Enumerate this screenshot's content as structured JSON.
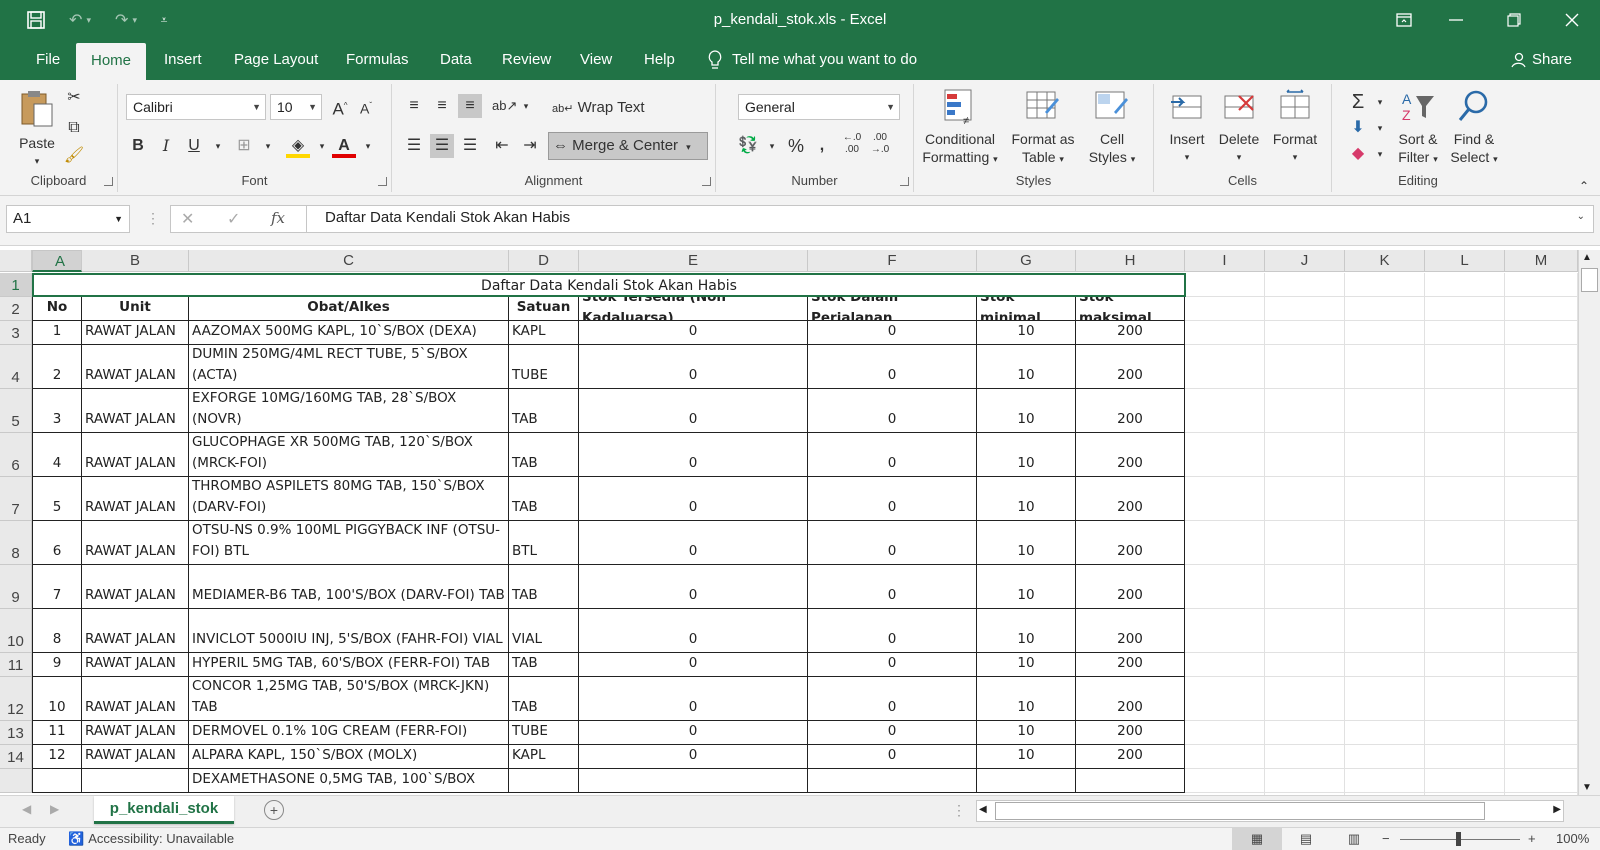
{
  "window": {
    "title": "p_kendali_stok.xls  -  Excel",
    "share_label": "Share"
  },
  "tabs": [
    "File",
    "Home",
    "Insert",
    "Page Layout",
    "Formulas",
    "Data",
    "Review",
    "View",
    "Help"
  ],
  "tell_me": "Tell me what you want to do",
  "ribbon": {
    "clipboard": {
      "label": "Clipboard",
      "paste": "Paste"
    },
    "font": {
      "label": "Font",
      "name": "Calibri",
      "size": "10",
      "bold": "B",
      "italic": "I",
      "underline": "U"
    },
    "alignment": {
      "label": "Alignment",
      "wrap": "Wrap Text",
      "merge": "Merge & Center"
    },
    "number": {
      "label": "Number",
      "format": "General",
      "percent": "%",
      "comma": "⁹",
      "inc": "←.0\n.00",
      "dec": ".00\n→.0"
    },
    "styles": {
      "label": "Styles",
      "conditional": [
        "Conditional",
        "Formatting"
      ],
      "format_table": [
        "Format as",
        "Table"
      ],
      "cell_styles": [
        "Cell",
        "Styles"
      ]
    },
    "cells": {
      "label": "Cells",
      "insert": "Insert",
      "delete": "Delete",
      "format": "Format"
    },
    "editing": {
      "label": "Editing",
      "sort": [
        "Sort &",
        "Filter"
      ],
      "find": [
        "Find &",
        "Select"
      ]
    }
  },
  "formula_bar": {
    "name_box": "A1",
    "fx": "fx",
    "content": "Daftar Data Kendali Stok Akan Habis"
  },
  "columns": [
    "A",
    "B",
    "C",
    "D",
    "E",
    "F",
    "G",
    "H",
    "I",
    "J",
    "K",
    "L",
    "M"
  ],
  "sheet": {
    "title": "Daftar Data Kendali Stok Akan Habis",
    "headers": [
      "No",
      "Unit",
      "Obat/Alkes",
      "Satuan",
      "Stok Tersedia (Non Kadaluarsa)",
      "Stok Dalam Perjalanan",
      "Stok minimal",
      "Stok maksimal"
    ],
    "rows": [
      {
        "row": "3",
        "no": "1",
        "unit": "RAWAT JALAN",
        "obat": "AAZOMAX 500MG KAPL, 10`S/BOX (DEXA)",
        "satuan": "KAPL",
        "tersedia": "0",
        "perjalanan": "0",
        "min": "10",
        "max": "200"
      },
      {
        "row": "4",
        "no": "2",
        "unit": "RAWAT JALAN",
        "obat": "DUMIN 250MG/4ML RECT TUBE, 5`S/BOX (ACTA)",
        "satuan": "TUBE",
        "tersedia": "0",
        "perjalanan": "0",
        "min": "10",
        "max": "200"
      },
      {
        "row": "5",
        "no": "3",
        "unit": "RAWAT JALAN",
        "obat": "EXFORGE 10MG/160MG TAB, 28`S/BOX (NOVR)",
        "satuan": "TAB",
        "tersedia": "0",
        "perjalanan": "0",
        "min": "10",
        "max": "200"
      },
      {
        "row": "6",
        "no": "4",
        "unit": "RAWAT JALAN",
        "obat": "GLUCOPHAGE XR 500MG TAB, 120`S/BOX (MRCK-FOI)",
        "satuan": "TAB",
        "tersedia": "0",
        "perjalanan": "0",
        "min": "10",
        "max": "200"
      },
      {
        "row": "7",
        "no": "5",
        "unit": "RAWAT JALAN",
        "obat": "THROMBO ASPILETS 80MG TAB, 150`S/BOX (DARV-FOI)",
        "satuan": "TAB",
        "tersedia": "0",
        "perjalanan": "0",
        "min": "10",
        "max": "200"
      },
      {
        "row": "8",
        "no": "6",
        "unit": "RAWAT JALAN",
        "obat": "OTSU-NS 0.9% 100ML PIGGYBACK INF (OTSU-FOI) BTL",
        "satuan": "BTL",
        "tersedia": "0",
        "perjalanan": "0",
        "min": "10",
        "max": "200"
      },
      {
        "row": "9",
        "no": "7",
        "unit": "RAWAT JALAN",
        "obat": "MEDIAMER-B6 TAB, 100'S/BOX (DARV-FOI) TAB",
        "satuan": "TAB",
        "tersedia": "0",
        "perjalanan": "0",
        "min": "10",
        "max": "200"
      },
      {
        "row": "10",
        "no": "8",
        "unit": "RAWAT JALAN",
        "obat": "INVICLOT 5000IU INJ, 5'S/BOX (FAHR-FOI) VIAL",
        "satuan": "VIAL",
        "tersedia": "0",
        "perjalanan": "0",
        "min": "10",
        "max": "200"
      },
      {
        "row": "11",
        "no": "9",
        "unit": "RAWAT JALAN",
        "obat": "HYPERIL 5MG TAB, 60'S/BOX (FERR-FOI) TAB",
        "satuan": "TAB",
        "tersedia": "0",
        "perjalanan": "0",
        "min": "10",
        "max": "200"
      },
      {
        "row": "12",
        "no": "10",
        "unit": "RAWAT JALAN",
        "obat": "CONCOR 1,25MG TAB, 50'S/BOX (MRCK-JKN) TAB",
        "satuan": "TAB",
        "tersedia": "0",
        "perjalanan": "0",
        "min": "10",
        "max": "200"
      },
      {
        "row": "13",
        "no": "11",
        "unit": "RAWAT JALAN",
        "obat": "DERMOVEL 0.1% 10G CREAM (FERR-FOI)",
        "satuan": "TUBE",
        "tersedia": "0",
        "perjalanan": "0",
        "min": "10",
        "max": "200"
      },
      {
        "row": "14",
        "no": "12",
        "unit": "RAWAT JALAN",
        "obat": "ALPARA KAPL, 150`S/BOX (MOLX)",
        "satuan": "KAPL",
        "tersedia": "0",
        "perjalanan": "0",
        "min": "10",
        "max": "200"
      },
      {
        "row": "",
        "no": "",
        "unit": "",
        "obat": "DEXAMETHASONE 0,5MG TAB, 100`S/BOX",
        "satuan": "",
        "tersedia": "",
        "perjalanan": "",
        "min": "",
        "max": ""
      }
    ]
  },
  "sheet_tab": "p_kendali_stok",
  "status": {
    "ready": "Ready",
    "accessibility": "Accessibility: Unavailable",
    "zoom": "100%"
  }
}
